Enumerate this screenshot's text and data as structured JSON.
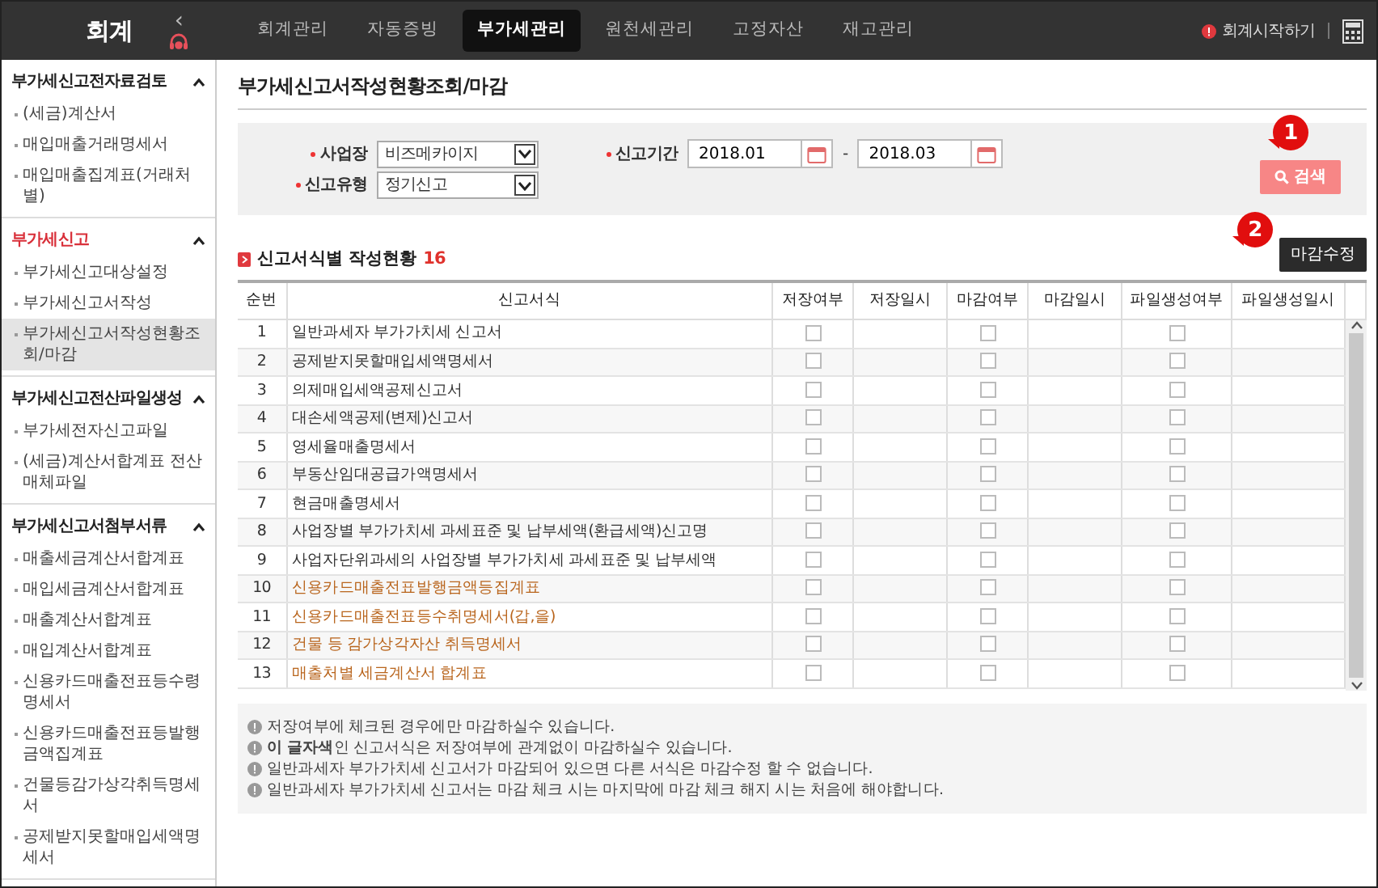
{
  "app": {
    "title": "회계",
    "collapse": "‹"
  },
  "top_nav": [
    {
      "label": "회계관리",
      "selected": false
    },
    {
      "label": "자동증빙",
      "selected": false
    },
    {
      "label": "부가세관리",
      "selected": true
    },
    {
      "label": "원천세관리",
      "selected": false
    },
    {
      "label": "고정자산",
      "selected": false
    },
    {
      "label": "재고관리",
      "selected": false
    }
  ],
  "start_link": "회계시작하기",
  "sidebar": [
    {
      "title": "부가세신고전자료검토",
      "current": false,
      "expanded": true,
      "items": [
        {
          "label": "(세금)계산서",
          "selected": false
        },
        {
          "label": "매입매출거래명세서",
          "selected": false
        },
        {
          "label": "매입매출집계표(거래처별)",
          "selected": false
        }
      ]
    },
    {
      "title": "부가세신고",
      "current": true,
      "expanded": true,
      "items": [
        {
          "label": "부가세신고대상설정",
          "selected": false
        },
        {
          "label": "부가세신고서작성",
          "selected": false
        },
        {
          "label": "부가세신고서작성현황조회/마감",
          "selected": true
        }
      ]
    },
    {
      "title": "부가세신고전산파일생성",
      "current": false,
      "expanded": true,
      "items": [
        {
          "label": "부가세전자신고파일",
          "selected": false
        },
        {
          "label": "(세금)계산서합계표 전산매체파일",
          "selected": false
        }
      ]
    },
    {
      "title": "부가세신고서첨부서류",
      "current": false,
      "expanded": true,
      "items": [
        {
          "label": "매출세금계산서합계표",
          "selected": false
        },
        {
          "label": "매입세금계산서합계표",
          "selected": false
        },
        {
          "label": "매출계산서합계표",
          "selected": false
        },
        {
          "label": "매입계산서합계표",
          "selected": false
        },
        {
          "label": "신용카드매출전표등수령명세서",
          "selected": false
        },
        {
          "label": "신용카드매출전표등발행금액집계표",
          "selected": false
        },
        {
          "label": "건물등감가상각취득명세서",
          "selected": false
        },
        {
          "label": "공제받지못할매입세액명세서",
          "selected": false
        }
      ]
    }
  ],
  "page_title": "부가세신고서작성현황조회/마감",
  "filters": {
    "business_label": "사업장",
    "business_value": "비즈메카이지",
    "type_label": "신고유형",
    "type_value": "정기신고",
    "period_label": "신고기간",
    "period_from": "2018.01",
    "period_sep": "-",
    "period_to": "2018.03",
    "search_button": "검색"
  },
  "callouts": [
    "1",
    "2"
  ],
  "section": {
    "title": "신고서식별 작성현황",
    "count": "16",
    "close_button": "마감수정"
  },
  "table": {
    "columns": [
      "순번",
      "신고서식",
      "저장여부",
      "저장일시",
      "마감여부",
      "마감일시",
      "파일생성여부",
      "파일생성일시"
    ],
    "rows": [
      {
        "no": "1",
        "form": "일반과세자 부가가치세 신고서",
        "kind": "normal",
        "saved": false,
        "closed": false,
        "file_created": false
      },
      {
        "no": "2",
        "form": "공제받지못할매입세액명세서",
        "kind": "normal",
        "saved": false,
        "closed": false,
        "file_created": false
      },
      {
        "no": "3",
        "form": "의제매입세액공제신고서",
        "kind": "normal",
        "saved": false,
        "closed": false,
        "file_created": false
      },
      {
        "no": "4",
        "form": "대손세액공제(변제)신고서",
        "kind": "normal",
        "saved": false,
        "closed": false,
        "file_created": false
      },
      {
        "no": "5",
        "form": "영세율매출명세서",
        "kind": "normal",
        "saved": false,
        "closed": false,
        "file_created": false
      },
      {
        "no": "6",
        "form": "부동산임대공급가액명세서",
        "kind": "normal",
        "saved": false,
        "closed": false,
        "file_created": false
      },
      {
        "no": "7",
        "form": "현금매출명세서",
        "kind": "normal",
        "saved": false,
        "closed": false,
        "file_created": false
      },
      {
        "no": "8",
        "form": "사업장별 부가가치세 과세표준 및 납부세액(환급세액)신고명",
        "kind": "normal",
        "saved": false,
        "closed": false,
        "file_created": false
      },
      {
        "no": "9",
        "form": "사업자단위과세의 사업장별 부가가치세 과세표준 및 납부세액",
        "kind": "normal",
        "saved": false,
        "closed": false,
        "file_created": false
      },
      {
        "no": "10",
        "form": "신용카드매출전표발행금액등집계표",
        "kind": "exempt",
        "saved": false,
        "closed": false,
        "file_created": false
      },
      {
        "no": "11",
        "form": "신용카드매출전표등수취명세서(갑,을)",
        "kind": "exempt",
        "saved": false,
        "closed": false,
        "file_created": false
      },
      {
        "no": "12",
        "form": "건물 등 감가상각자산 취득명세서",
        "kind": "exempt",
        "saved": false,
        "closed": false,
        "file_created": false
      },
      {
        "no": "13",
        "form": "매출처별 세금계산서 합계표",
        "kind": "exempt",
        "saved": false,
        "closed": false,
        "file_created": false
      }
    ]
  },
  "notes": [
    "저장여부에 체크된 경우에만 마감하실수 있습니다.",
    "**이 글자색**인 신고서식은 저장여부에 관계없이 마감하실수 있습니다.",
    "일반과세자 부가가치세 신고서가 마감되어 있으면 다른 서식은 마감수정 할 수 없습니다.",
    "일반과세자 부가가치세 신고서는 마감 체크 시는 마지막에 마감 체크 해지 시는 처음에 해야합니다."
  ]
}
